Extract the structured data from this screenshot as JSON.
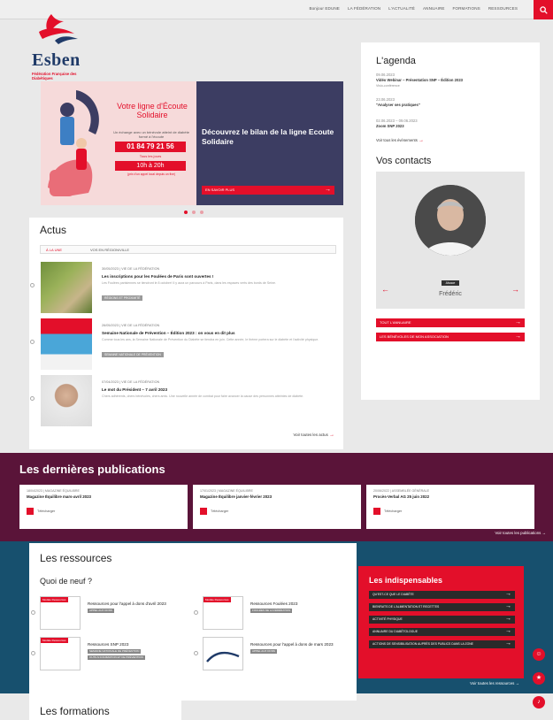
{
  "nav": {
    "items": [
      "Bonjour EDUNE",
      "LA FÉDÉRATION",
      "L'ACTUALITÉ",
      "ANNUAIRE",
      "FORMATIONS",
      "RESSOURCES"
    ]
  },
  "logo": {
    "name": "Esben",
    "subtitle": "Fédération Française des Diabétiques"
  },
  "hero": {
    "image_title": "Votre ligne d'Écoute Solidaire",
    "image_text": "Un échange avec un bénévole atteint de diabète formé à l'écoute",
    "phone": "01 84 79 21 56",
    "days": "Tous les jours",
    "hours": "10h à 20h",
    "note": "(prix d'un appel local depuis un fixe)",
    "title": "Découvrez le bilan de la ligne Ecoute Solidaire",
    "button": "EN SAVOIR PLUS"
  },
  "actus": {
    "title": "Actus",
    "tabs": [
      "À LA UNE",
      "VOS EN RÉGION/VILLE"
    ],
    "items": [
      {
        "meta": "30/05/2023 | VIE DE LA FÉDÉRATION",
        "title": "Les inscriptions pour les Foulées de Paris sont ouvertes !",
        "excerpt": "Les Foulées parisiennes se tiendront le 8 octobre! Il y aura un parcours à Paris, dans les espaces verts des bords de Seine.",
        "tag": "RÉGIONS ET PROXIMITÉ"
      },
      {
        "meta": "26/05/2023 | VIE DE LA FÉDÉRATION",
        "title": "Semaine Nationale de Prévention – Édition 2023 : on vous en dit plus",
        "excerpt": "Comme tous les ans, la Semaine Nationale de Prévention du Diabète se tiendra en juin. Cette année, le thème portera sur le diabète et l'activité physique.",
        "tag": "SEMAINE NATIONALE DE PRÉVENTION"
      },
      {
        "meta": "07/04/2023 | VIE DE LA FÉDÉRATION",
        "title": "Le mot du Président – 7 avril 2023",
        "excerpt": "Chers adhérents, chers bénévoles, chers amis. Une nouvelle année de combat pour faire avancer la cause des personnes atteintes de diabète.",
        "tag": ""
      }
    ],
    "more": "Voir toutes les actus"
  },
  "agenda": {
    "title": "L'agenda",
    "events": [
      {
        "date": "09.06.2023",
        "name": "Vidéo Webinar – Présentation SNP – Édition 2023",
        "place": "Visio-conférence"
      },
      {
        "date": "23.06.2023",
        "name": "\"Analyser ses pratiques\"",
        "place": ""
      },
      {
        "date": "02.06.2023 – 09.06.2023",
        "name": "Zoom SNP 2023",
        "place": ""
      }
    ],
    "more": "Voir tous les événements"
  },
  "contacts": {
    "title": "Vos contacts",
    "role": "Alsace",
    "name": "Frédéric",
    "btn1": "TOUT L'ANNUAIRE",
    "btn2": "LES BÉNÉVOLES DE MON ASSOCIATION"
  },
  "publications": {
    "title": "Les dernières publications",
    "items": [
      {
        "meta": "18/04/2023 | MAGAZINE ÉQUILIBRE",
        "title": "Magazine Équilibre mars-avril 2023",
        "download": "Télécharger"
      },
      {
        "meta": "17/01/2023 | MAGAZINE ÉQUILIBRE",
        "title": "Magazine Équilibre janvier-février 2023",
        "download": "Télécharger"
      },
      {
        "meta": "20/06/2022 | ASSEMBLÉE GÉNÉRALE",
        "title": "Procès-Verbal AG 25 juin 2022",
        "download": "Télécharger"
      }
    ],
    "more": "Voir toutes les publications"
  },
  "ressources": {
    "title": "Les ressources",
    "subtitle": "Quoi de neuf ?",
    "items": [
      {
        "label": "Modèle Ressources",
        "title": "Ressources pour l'appel à dons d'avril 2023",
        "tag": "APPEL AUX DONS"
      },
      {
        "label": "Modèle Ressources",
        "title": "Ressources Foulées 2023",
        "tag": "FOULÉES DE LA FÉDÉRATION"
      },
      {
        "label": "Modèle Ressources",
        "title": "Ressources SNP 2023",
        "tag": "SEMAINE NATIONALE DE PRÉVENTION"
      },
      {
        "label": "Modèle Ressources",
        "title": "Ressources pour l'appel à dons de mars 2023",
        "tag": "APPEL AUX DONS"
      }
    ],
    "tag_extra": "OUTILS D'ANIMATION ET DE PRÉVENTION",
    "indispensables_title": "Les indispensables",
    "links": [
      "QU'EST-CE QUE LE DIABÈTE",
      "BIENFAITS DE L'ALIMENTATION ET RECETTES",
      "ACTIVITÉ PHYSIQUE",
      "ANNUAIRE DU DIABÉTOLOGUE",
      "ACTIONS DE SENSIBILISATION AUPRÈS DES PUBLICS DANS LA ZONE"
    ],
    "more": "Voir toutes les ressources"
  },
  "formations": {
    "title": "Les formations"
  },
  "colors": {
    "accent": "#e30f2a",
    "navy": "#3c3d62",
    "plum": "#5a1439",
    "teal": "#17506e"
  }
}
